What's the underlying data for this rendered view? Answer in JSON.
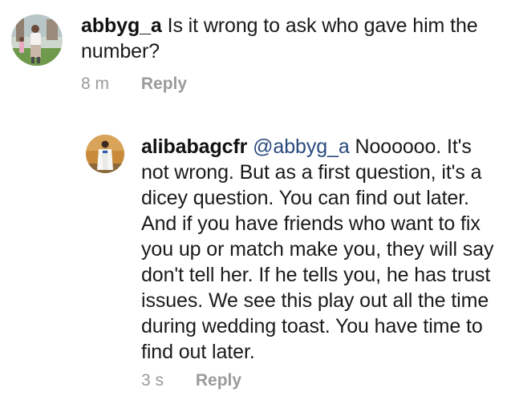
{
  "comments": [
    {
      "username": "abbyg_a",
      "text": "Is it wrong to ask who gave him the number?",
      "time": "8 m",
      "reply_label": "Reply",
      "avatar_icon": "profile-photo-woman-outdoors"
    },
    {
      "username": "alibabagcfr",
      "mention": "@abbyg_a",
      "text": "Noooooo. It's not wrong. But as a first question, it's a dicey question. You can find out later. And if you have friends who want to fix you up or match make you, they will say don't tell her. If he tells you, he has trust issues. We see this play out all the time during wedding toast. You have time to find out later.",
      "time": "3 s",
      "reply_label": "Reply",
      "avatar_icon": "profile-photo-man-white-robe"
    }
  ],
  "colors": {
    "background": "#ffffff",
    "text": "#111111",
    "meta": "#9a9a9a",
    "mention": "#2a4a7e"
  }
}
